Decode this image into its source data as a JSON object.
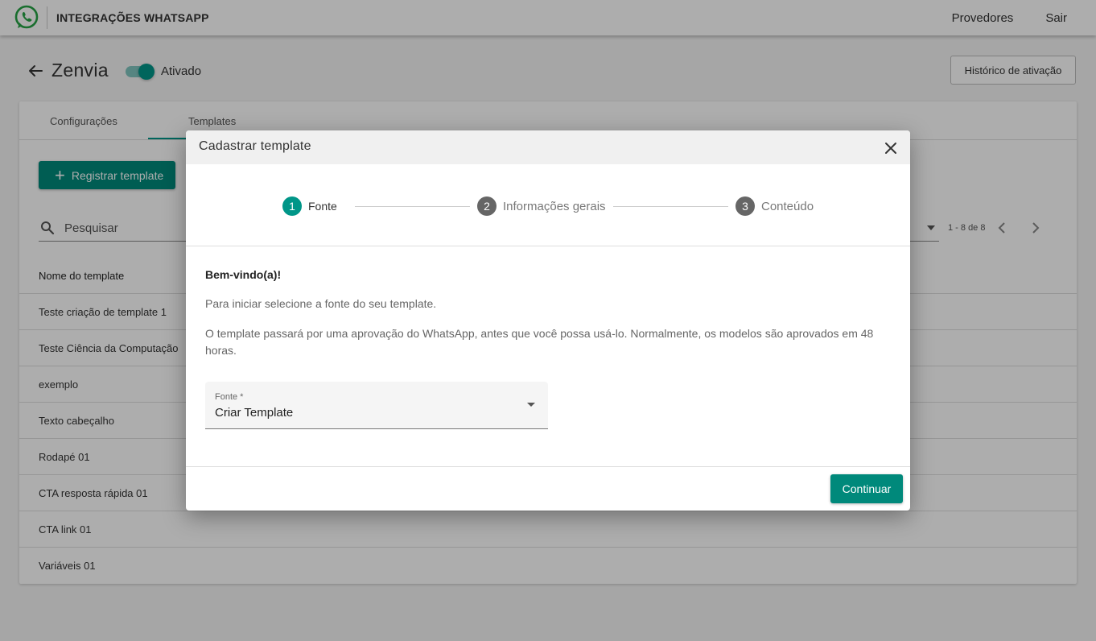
{
  "topbar": {
    "app_title": "INTEGRAÇÕES WHATSAPP",
    "nav": [
      "Provedores",
      "Sair"
    ]
  },
  "header": {
    "title": "Zenvia",
    "toggle_label": "Ativado",
    "toggle_on": true,
    "history_button": "Histórico de ativação"
  },
  "tabs": [
    "Configurações",
    "Templates"
  ],
  "active_tab": "Templates",
  "toolbar": {
    "register_button": "Registrar template",
    "search_placeholder": "Pesquisar",
    "pager_text": "1 - 8 de 8"
  },
  "table": {
    "column": "Nome do template",
    "rows": [
      "Teste criação de template 1",
      "Teste Ciência da Computação",
      "exemplo",
      "Texto cabeçalho",
      "Rodapé 01",
      "CTA resposta rápida 01",
      "CTA link 01",
      "Variáveis 01"
    ]
  },
  "dialog": {
    "title": "Cadastrar template",
    "steps": [
      {
        "number": "1",
        "label": "Fonte"
      },
      {
        "number": "2",
        "label": "Informações gerais"
      },
      {
        "number": "3",
        "label": "Conteúdo"
      }
    ],
    "active_step": 1,
    "welcome": "Bem-vindo(a)!",
    "paragraph1": "Para iniciar selecione a fonte do seu template.",
    "paragraph2": "O template passará por uma aprovação do WhatsApp, antes que você possa usá-lo. Normalmente, os modelos são aprovados em 48 horas.",
    "select_label": "Fonte *",
    "select_value": "Criar Template",
    "continue_button": "Continuar"
  },
  "colors": {
    "accent": "#009688",
    "button": "#00897b",
    "whatsapp": "#25a244"
  }
}
